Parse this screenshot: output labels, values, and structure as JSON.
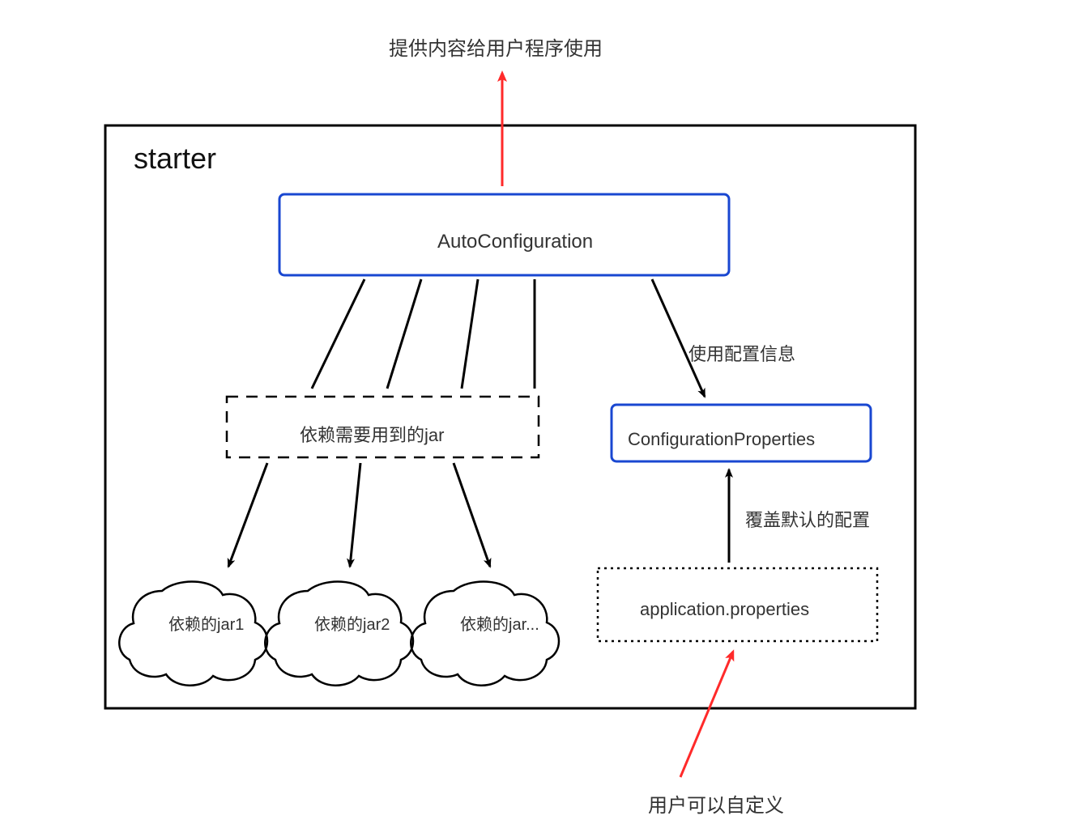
{
  "diagram": {
    "top_annotation": "提供内容给用户程序使用",
    "container_title": "starter",
    "autoconfig_box": "AutoConfiguration",
    "use_config_info": "使用配置信息",
    "jar_dependencies_box": "依赖需要用到的jar",
    "config_properties_box": "ConfigurationProperties",
    "override_default_config": "覆盖默认的配置",
    "jar1": "依赖的jar1",
    "jar2": "依赖的jar2",
    "jar3": "依赖的jar...",
    "app_properties_box": "application.properties",
    "user_custom": "用户可以自定义"
  },
  "colors": {
    "red_arrow": "#ff2a2a",
    "blue_box": "#1947d1",
    "black": "#000000",
    "gray_text": "#333333"
  }
}
